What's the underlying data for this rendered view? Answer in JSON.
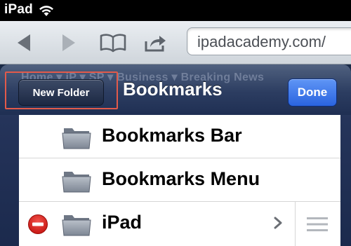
{
  "status_bar": {
    "device": "iPad"
  },
  "toolbar": {
    "url": "ipadacademy.com/"
  },
  "page_behind": {
    "nav_text": "Home ▾   iP   ▾   SP ▾    Business ▾      Breaking News"
  },
  "popover": {
    "title": "Bookmarks",
    "new_folder_label": "New Folder",
    "done_label": "Done",
    "items": [
      {
        "label": "Bookmarks Bar"
      },
      {
        "label": "Bookmarks Menu"
      },
      {
        "label": "iPad"
      }
    ]
  },
  "colors": {
    "done_blue": "#2a64e0",
    "highlight": "#e35a4a",
    "delete_red": "#d6201b"
  }
}
